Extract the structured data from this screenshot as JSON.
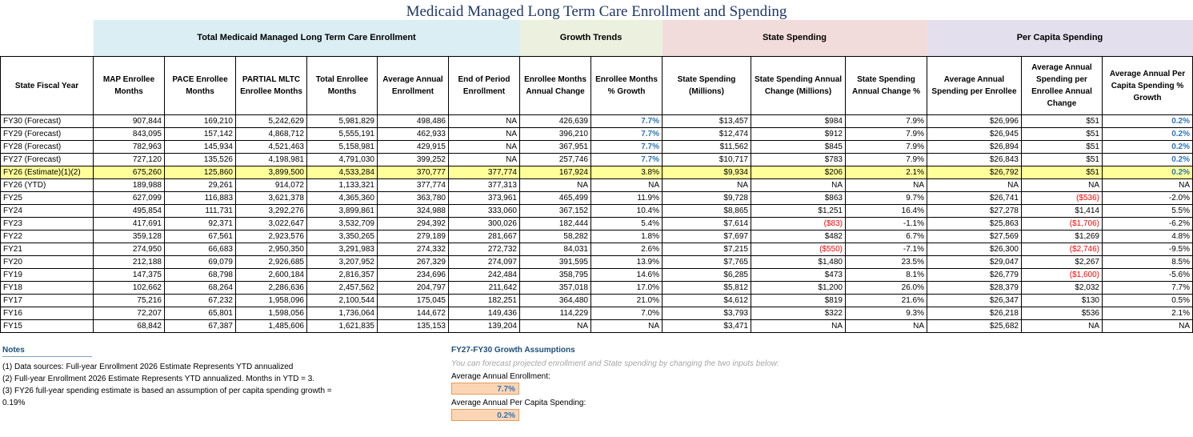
{
  "title": "Medicaid Managed Long Term Care Enrollment and Spending",
  "bands": [
    {
      "label": "Total Medicaid Managed Long Term Care Enrollment",
      "color": "#daeef3"
    },
    {
      "label": "Growth Trends",
      "color": "#ebf1de"
    },
    {
      "label": "State Spending",
      "color": "#f2dcdb"
    },
    {
      "label": "Per Capita Spending",
      "color": "#e4dfec"
    }
  ],
  "headers": [
    "State Fiscal Year",
    "MAP Enrollee Months",
    "PACE Enrollee Months",
    "PARTIAL MLTC Enrollee Months",
    "Total Enrollee Months",
    "Average Annual Enrollment",
    "End of Period Enrollment",
    "Enrollee Months Annual Change",
    "Enrollee Months % Growth",
    "State Spending (Millions)",
    "State Spending Annual Change (Millions)",
    "State Spending Annual Change %",
    "Average Annual Spending per Enrollee",
    "Average Annual Spending per Enrollee Annual Change",
    "Average Annual Per Capita Spending % Growth"
  ],
  "rows": [
    [
      "FY30 (Forecast)",
      "907,844",
      "169,210",
      "5,242,629",
      "5,981,829",
      "498,486",
      "NA",
      "426,639",
      "7.7%",
      "$13,457",
      "$984",
      "7.9%",
      "$26,996",
      "$51",
      "0.2%"
    ],
    [
      "FY29 (Forecast)",
      "843,095",
      "157,142",
      "4,868,712",
      "5,555,191",
      "462,933",
      "NA",
      "396,210",
      "7.7%",
      "$12,474",
      "$912",
      "7.9%",
      "$26,945",
      "$51",
      "0.2%"
    ],
    [
      "FY28 (Forecast)",
      "782,963",
      "145,934",
      "4,521,463",
      "5,158,981",
      "429,915",
      "NA",
      "367,951",
      "7.7%",
      "$11,562",
      "$845",
      "7.9%",
      "$26,894",
      "$51",
      "0.2%"
    ],
    [
      "FY27 (Forecast)",
      "727,120",
      "135,526",
      "4,198,981",
      "4,791,030",
      "399,252",
      "NA",
      "257,746",
      "7.7%",
      "$10,717",
      "$783",
      "7.9%",
      "$26,843",
      "$51",
      "0.2%"
    ],
    [
      "FY26 (Estimate)(1)(2)",
      "675,260",
      "125,860",
      "3,899,500",
      "4,533,284",
      "370,777",
      "377,774",
      "167,924",
      "3.8%",
      "$9,934",
      "$206",
      "2.1%",
      "$26,792",
      "$51",
      "0.2%"
    ],
    [
      "FY26 (YTD)",
      "189,988",
      "29,261",
      "914,072",
      "1,133,321",
      "377,774",
      "377,313",
      "NA",
      "NA",
      "NA",
      "NA",
      "NA",
      "NA",
      "NA",
      "NA"
    ],
    [
      "FY25",
      "627,099",
      "116,883",
      "3,621,378",
      "4,365,360",
      "363,780",
      "373,961",
      "465,499",
      "11.9%",
      "$9,728",
      "$863",
      "9.7%",
      "$26,741",
      "($536)",
      "-2.0%"
    ],
    [
      "FY24",
      "495,854",
      "111,731",
      "3,292,276",
      "3,899,861",
      "324,988",
      "333,060",
      "367,152",
      "10.4%",
      "$8,865",
      "$1,251",
      "16.4%",
      "$27,278",
      "$1,414",
      "5.5%"
    ],
    [
      "FY23",
      "417,691",
      "92,371",
      "3,022,647",
      "3,532,709",
      "294,392",
      "300,026",
      "182,444",
      "5.4%",
      "$7,614",
      "($83)",
      "-1.1%",
      "$25,863",
      "($1,706)",
      "-6.2%"
    ],
    [
      "FY22",
      "359,128",
      "67,561",
      "2,923,576",
      "3,350,265",
      "279,189",
      "281,667",
      "58,282",
      "1.8%",
      "$7,697",
      "$482",
      "6.7%",
      "$27,569",
      "$1,269",
      "4.8%"
    ],
    [
      "FY21",
      "274,950",
      "66,683",
      "2,950,350",
      "3,291,983",
      "274,332",
      "272,732",
      "84,031",
      "2.6%",
      "$7,215",
      "($550)",
      "-7.1%",
      "$26,300",
      "($2,746)",
      "-9.5%"
    ],
    [
      "FY20",
      "212,188",
      "69,079",
      "2,926,685",
      "3,207,952",
      "267,329",
      "274,097",
      "391,595",
      "13.9%",
      "$7,765",
      "$1,480",
      "23.5%",
      "$29,047",
      "$2,267",
      "8.5%"
    ],
    [
      "FY19",
      "147,375",
      "68,798",
      "2,600,184",
      "2,816,357",
      "234,696",
      "242,484",
      "358,795",
      "14.6%",
      "$6,285",
      "$473",
      "8.1%",
      "$26,779",
      "($1,600)",
      "-5.6%"
    ],
    [
      "FY18",
      "102,662",
      "68,264",
      "2,286,636",
      "2,457,562",
      "204,797",
      "211,642",
      "357,018",
      "17.0%",
      "$5,812",
      "$1,200",
      "26.0%",
      "$28,379",
      "$2,032",
      "7.7%"
    ],
    [
      "FY17",
      "75,216",
      "67,232",
      "1,958,096",
      "2,100,544",
      "175,045",
      "182,251",
      "364,480",
      "21.0%",
      "$4,612",
      "$819",
      "21.6%",
      "$26,347",
      "$130",
      "0.5%"
    ],
    [
      "FY16",
      "72,207",
      "65,801",
      "1,598,056",
      "1,736,064",
      "144,672",
      "149,436",
      "114,229",
      "7.0%",
      "$3,793",
      "$322",
      "9.3%",
      "$26,218",
      "$536",
      "2.1%"
    ],
    [
      "FY15",
      "68,842",
      "67,387",
      "1,485,606",
      "1,621,835",
      "135,153",
      "139,204",
      "NA",
      "NA",
      "$3,471",
      "NA",
      "NA",
      "$25,682",
      "NA",
      "NA"
    ]
  ],
  "notes": {
    "title": "Notes",
    "lines": [
      "(1) Data sources: Full-year Enrollment 2026 Estimate Represents YTD annualized",
      "(2) Full-year Enrollment 2026 Estimate Represents YTD annualized. Months in YTD = 3.",
      "(3) FY26 full-year spending estimate is based an assumption of per capita spending growth = 0.19%"
    ]
  },
  "assumptions": {
    "title": "FY27-FY30 Growth Assumptions",
    "description": "You can forecast projected enrollment and State spending by changing the two inputs below:",
    "enrollment_label": "Average Annual Enrollment:",
    "enrollment_value": "7.7%",
    "spending_label": "Average Annual Per Capita Spending:",
    "spending_value": "0.2%"
  },
  "colors": {
    "highlight_row": "#ffff99",
    "blue_text": "#2e75b6",
    "negative_text": "#ff0000",
    "input_fill": "#fcd5b4"
  }
}
